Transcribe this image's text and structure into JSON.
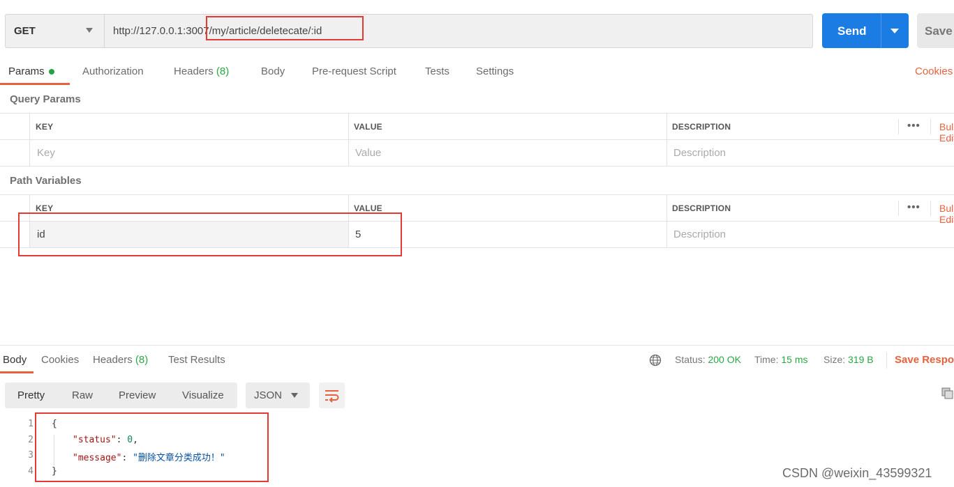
{
  "request": {
    "method": "GET",
    "url": "http://127.0.0.1:3007/my/article/deletecate/:id",
    "send_label": "Send",
    "save_label": "Save"
  },
  "request_tabs": [
    {
      "label": "Params"
    },
    {
      "label": "Authorization"
    },
    {
      "label": "Headers",
      "count": "(8)"
    },
    {
      "label": "Body"
    },
    {
      "label": "Pre-request Script"
    },
    {
      "label": "Tests"
    },
    {
      "label": "Settings"
    }
  ],
  "cookies_label": "Cookies",
  "query_params": {
    "title": "Query Params",
    "headers": {
      "key": "KEY",
      "value": "VALUE",
      "description": "DESCRIPTION"
    },
    "bulk_label": "Bulk Edit",
    "placeholder": {
      "key": "Key",
      "value": "Value",
      "description": "Description"
    }
  },
  "path_variables": {
    "title": "Path Variables",
    "headers": {
      "key": "KEY",
      "value": "VALUE",
      "description": "DESCRIPTION"
    },
    "bulk_label": "Bulk Edit",
    "rows": [
      {
        "key": "id",
        "value": "5",
        "description_placeholder": "Description"
      }
    ]
  },
  "response_tabs": [
    {
      "label": "Body"
    },
    {
      "label": "Cookies"
    },
    {
      "label": "Headers",
      "count": "(8)"
    },
    {
      "label": "Test Results"
    }
  ],
  "response_status": {
    "status_label": "Status:",
    "status_value": "200 OK",
    "time_label": "Time:",
    "time_value": "15 ms",
    "size_label": "Size:",
    "size_value": "319 B",
    "save_response_label": "Save Response"
  },
  "view_modes": [
    "Pretty",
    "Raw",
    "Preview",
    "Visualize"
  ],
  "format": "JSON",
  "response_body": {
    "line_numbers": [
      "1",
      "2",
      "3",
      "4"
    ],
    "open_brace": "{",
    "close_brace": "}",
    "status_key": "\"status\"",
    "status_value": "0",
    "message_key": "\"message\"",
    "message_value": "\"删除文章分类成功！\""
  },
  "watermark": "CSDN @weixin_43599321",
  "colors": {
    "accent": "#e8613c",
    "send": "#1b7ce3",
    "success": "#28a745",
    "annotation": "#e53935"
  }
}
